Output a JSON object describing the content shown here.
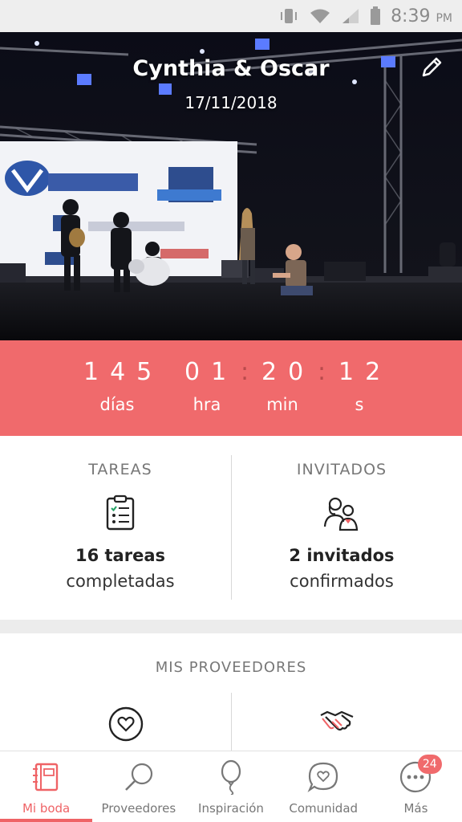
{
  "status_bar": {
    "time": "8:39",
    "ampm": "PM"
  },
  "hero": {
    "couple_names": "Cynthia & Oscar",
    "date": "17/11/2018",
    "edit_icon": "pencil-icon"
  },
  "countdown": {
    "days": "145",
    "hours": "01",
    "minutes": "20",
    "seconds": "12",
    "days_label": "días",
    "hours_label": "hra",
    "minutes_label": "min",
    "seconds_label": "s"
  },
  "tasks": {
    "title": "TAREAS",
    "count": "16 tareas",
    "subtitle": "completadas",
    "icon": "checklist-icon"
  },
  "guests": {
    "title": "INVITADOS",
    "count": "2 invitados",
    "subtitle": "confirmados",
    "icon": "couple-icon"
  },
  "providers": {
    "title": "MIS PROVEEDORES",
    "icons": [
      "heart-circle-icon",
      "handshake-icon"
    ]
  },
  "nav": {
    "items": [
      {
        "label": "Mi boda",
        "icon": "notebook-icon",
        "active": true
      },
      {
        "label": "Proveedores",
        "icon": "search-icon",
        "active": false
      },
      {
        "label": "Inspiración",
        "icon": "balloon-icon",
        "active": false
      },
      {
        "label": "Comunidad",
        "icon": "chat-heart-icon",
        "active": false
      },
      {
        "label": "Más",
        "icon": "more-icon",
        "active": false,
        "badge": "24"
      }
    ]
  },
  "colors": {
    "accent": "#f06a6c",
    "text_dark": "#222222",
    "text_muted": "#777777"
  }
}
